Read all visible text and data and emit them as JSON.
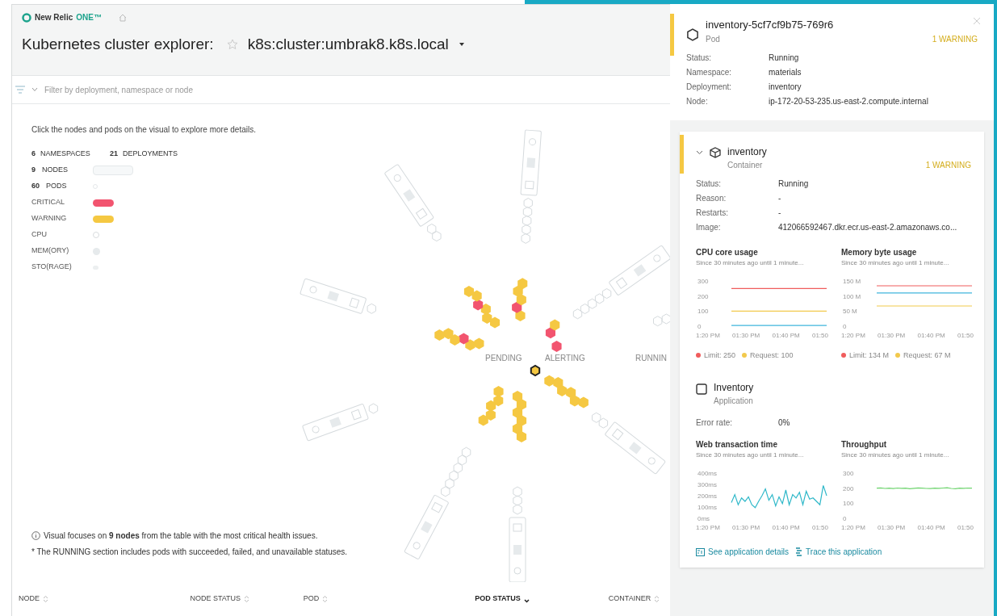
{
  "header": {
    "brand_name": "New Relic",
    "brand_product": "ONE™",
    "title": "Kubernetes cluster explorer:",
    "cluster": "k8s:cluster:umbrak8.k8s.local"
  },
  "filter": {
    "placeholder": "Filter by deployment, namespace or node"
  },
  "intro": "Click the nodes and pods on the visual to explore more details.",
  "counts": [
    {
      "value": "6",
      "label": "NAMESPACES"
    },
    {
      "value": "21",
      "label": "DEPLOYMENTS"
    }
  ],
  "legend": [
    {
      "kind": "node",
      "value": "9",
      "label": "NODES"
    },
    {
      "kind": "pod",
      "value": "60",
      "label": "PODS"
    },
    {
      "kind": "status",
      "label": "CRITICAL",
      "color": "#f2546f"
    },
    {
      "kind": "status",
      "label": "WARNING",
      "color": "#f5c842"
    },
    {
      "kind": "cpu",
      "label": "CPU"
    },
    {
      "kind": "memory",
      "label": "MEM(ORY)"
    },
    {
      "kind": "storage",
      "label": "STO(RAGE)"
    }
  ],
  "visual": {
    "section_labels": [
      "PENDING",
      "ALERTING",
      "RUNNIN"
    ]
  },
  "notes": [
    "Visual focuses on **9 nodes** from the table with the most critical health issues.",
    "* The RUNNING section includes pods with succeeded, failed, and unavailable statuses."
  ],
  "table": {
    "columns": [
      {
        "label": "NODE",
        "sorted": false
      },
      {
        "label": "NODE STATUS",
        "sorted": false
      },
      {
        "label": "POD",
        "sorted": false
      },
      {
        "label": "POD STATUS",
        "sorted": true
      },
      {
        "label": "CONTAINER",
        "sorted": false
      }
    ]
  },
  "panel": {
    "pod": {
      "name": "inventory-5cf7cf9b75-769r6",
      "type": "Pod",
      "color": "#f5c842",
      "badge": "1 WARNING",
      "details": [
        {
          "label": "Status:",
          "value": "Running"
        },
        {
          "label": "Namespace:",
          "value": "materials"
        },
        {
          "label": "Deployment:",
          "value": "inventory"
        },
        {
          "label": "Node:",
          "value": "ip-172-20-53-235.us-east-2.compute.internal"
        }
      ]
    },
    "container": {
      "name": "inventory",
      "type": "Container",
      "color": "#f5c842",
      "badge": "1 WARNING",
      "expanded": true,
      "details": [
        {
          "label": "Status:",
          "value": "Running"
        },
        {
          "label": "Reason:",
          "value": "-"
        },
        {
          "label": "Restarts:",
          "value": "-"
        },
        {
          "label": "Image:",
          "value": "412066592467.dkr.ecr.us-east-2.amazonaws.co..."
        }
      ],
      "charts": [
        {
          "title": "CPU core usage",
          "subtitle": "Since 30 minutes ago until 1 minute...",
          "legend": [
            {
              "label": "Limit: 250",
              "color": "#f05c5c"
            },
            {
              "label": "Request: 100",
              "color": "#f2c94c"
            }
          ],
          "x_labels": [
            "1:20 PM",
            "01:30 PM",
            "01:40 PM",
            "01:50"
          ],
          "chart_data": {
            "type": "line",
            "ylim": [
              0,
              300
            ],
            "yticks": [
              0,
              100,
              200,
              300
            ],
            "series": [
              {
                "color": "#f05c5c",
                "values": [
                  250,
                  250,
                  250,
                  250,
                  250,
                  250,
                  250,
                  250
                ]
              },
              {
                "color": "#f2c94c",
                "values": [
                  100,
                  100,
                  100,
                  100,
                  100,
                  100,
                  100,
                  100
                ]
              },
              {
                "color": "#3fb6dc",
                "values": [
                  5,
                  5,
                  5,
                  5,
                  5,
                  5,
                  5,
                  5
                ]
              }
            ]
          }
        },
        {
          "title": "Memory byte usage",
          "subtitle": "Since 30 minutes ago until 1 minute...",
          "legend": [
            {
              "label": "Limit: 134 M",
              "color": "#f05c5c"
            },
            {
              "label": "Request: 67 M",
              "color": "#f2c94c"
            }
          ],
          "x_labels": [
            "1:20 PM",
            "01:30 PM",
            "01:40 PM",
            "01:50"
          ],
          "chart_data": {
            "type": "line",
            "ylim": [
              0,
              150
            ],
            "yticks": [
              {
                "value": 0,
                "label": "0"
              },
              {
                "value": 50,
                "label": "50 M"
              },
              {
                "value": 100,
                "label": "100 M"
              },
              {
                "value": 150,
                "label": "150 M"
              }
            ],
            "series": [
              {
                "color": "#f05c5c",
                "values": [
                  134,
                  134,
                  134,
                  134,
                  134,
                  134,
                  134,
                  134
                ]
              },
              {
                "color": "#3fb6dc",
                "values": [
                  110,
                  110,
                  110,
                  110,
                  110,
                  110,
                  110,
                  110
                ]
              },
              {
                "color": "#f2c94c",
                "values": [
                  67,
                  67,
                  67,
                  67,
                  67,
                  67,
                  67,
                  67
                ]
              }
            ]
          }
        }
      ]
    },
    "application": {
      "name": "Inventory",
      "type": "Application",
      "error_label": "Error rate:",
      "error_value": "0%",
      "charts": [
        {
          "title": "Web transaction time",
          "subtitle": "Since 30 minutes ago until 1 minute...",
          "x_labels": [
            "1:20 PM",
            "01:30 PM",
            "01:40 PM",
            "01:50"
          ],
          "chart_data": {
            "type": "line",
            "ylim": [
              0,
              400
            ],
            "yticks": [
              {
                "value": 0,
                "label": "0ms"
              },
              {
                "value": 100,
                "label": "100ms"
              },
              {
                "value": 200,
                "label": "200ms"
              },
              {
                "value": 300,
                "label": "300ms"
              },
              {
                "value": 400,
                "label": "400ms"
              }
            ],
            "series": [
              {
                "color": "#2fb8c9",
                "values": [
                  140,
                  210,
                  120,
                  180,
                  150,
                  190,
                  120,
                  95,
                  150,
                  200,
                  260,
                  160,
                  210,
                  110,
                  190,
                  130,
                  250,
                  120,
                  210,
                  180,
                  230,
                  120,
                  240,
                  170,
                  180,
                  150,
                  120,
                  290,
                  200
                ]
              }
            ]
          }
        },
        {
          "title": "Throughput",
          "subtitle": "Since 30 minutes ago until 1 minute...",
          "x_labels": [
            "1:20 PM",
            "01:30 PM",
            "01:40 PM",
            "01:50"
          ],
          "chart_data": {
            "type": "line",
            "ylim": [
              0,
              300
            ],
            "yticks": [
              0,
              100,
              200,
              300
            ],
            "series": [
              {
                "color": "#6fd46f",
                "values": [
                  200,
                  202,
                  198,
                  200,
                  197,
                  201,
                  199,
                  200,
                  196,
                  199,
                  202,
                  200,
                  198,
                  197,
                  200,
                  199,
                  201,
                  203,
                  198,
                  196,
                  200,
                  199,
                  201,
                  200
                ]
              }
            ]
          }
        }
      ],
      "links": [
        "See application details",
        "Trace this application"
      ]
    }
  }
}
